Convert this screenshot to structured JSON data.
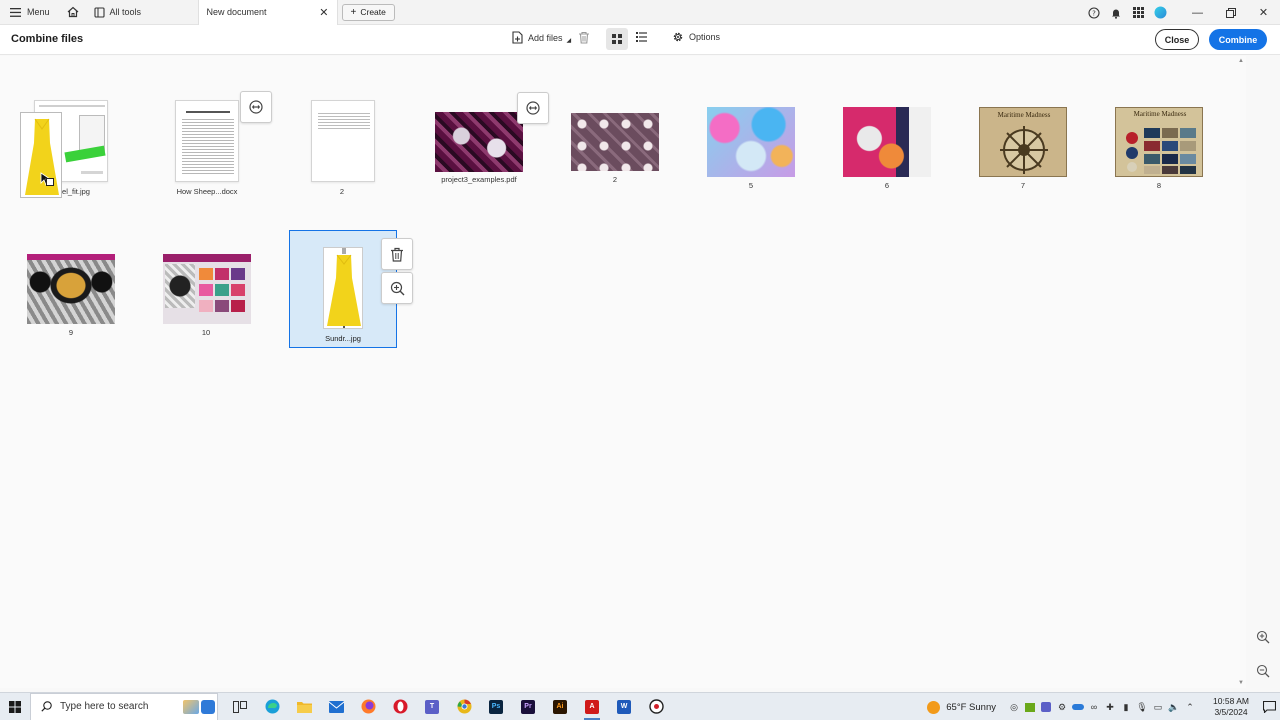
{
  "tabbar": {
    "menu_label": "Menu",
    "alltools_label": "All tools",
    "active_tab_label": "New document",
    "create_label": "Create"
  },
  "toolbar": {
    "title": "Combine files",
    "add_files_label": "Add files",
    "options_label": "Options",
    "close_label": "Close",
    "combine_label": "Combine"
  },
  "files": [
    {
      "label": "el_fit.jpg",
      "kind": "dragging-jpg"
    },
    {
      "label": "How Sheep...docx",
      "kind": "doc"
    },
    {
      "label": "2",
      "kind": "doc"
    },
    {
      "label": "project3_examples.pdf",
      "kind": "image"
    },
    {
      "label": "2",
      "kind": "image"
    },
    {
      "label": "5",
      "kind": "image"
    },
    {
      "label": "6",
      "kind": "image"
    },
    {
      "label": "7",
      "kind": "image"
    },
    {
      "label": "8",
      "kind": "image"
    },
    {
      "label": "9",
      "kind": "image"
    },
    {
      "label": "10",
      "kind": "image"
    },
    {
      "label": "Sundr...jpg",
      "kind": "jpg",
      "selected": true
    }
  ],
  "thumb_titles": {
    "maritime_7": "Maritime Madness",
    "maritime_8": "Maritime Madness"
  },
  "taskbar": {
    "search_placeholder": "Type here to search",
    "weather_text": "65°F  Sunny",
    "time": "10:58 AM",
    "date": "3/5/2024"
  },
  "colors": {
    "accent": "#1473e6",
    "selection_bg": "#d7e9f8",
    "dress_yellow": "#f2d31b"
  }
}
